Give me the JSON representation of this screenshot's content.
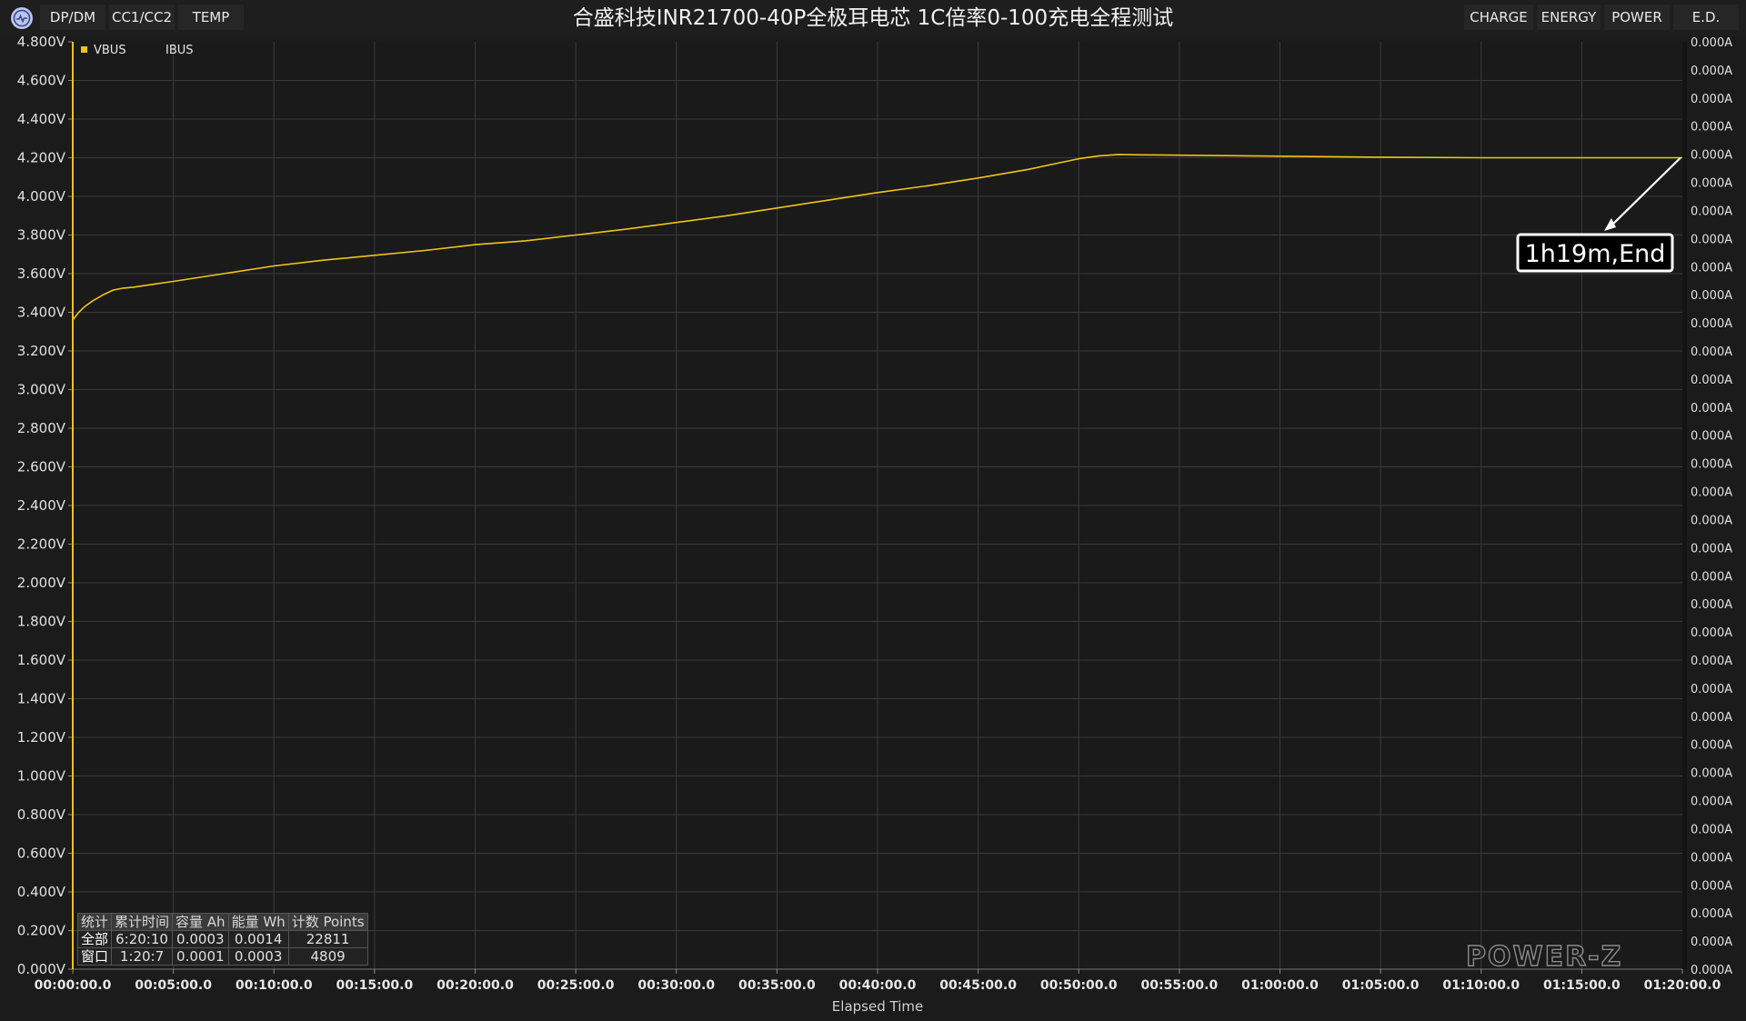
{
  "header": {
    "title": "合盛科技INR21700-40P全极耳电芯 1C倍率0-100充电全程测试",
    "left_tabs": [
      "DP/DM",
      "CC1/CC2",
      "TEMP"
    ],
    "right_tabs": [
      "CHARGE",
      "ENERGY",
      "POWER",
      "E.D."
    ]
  },
  "colors": {
    "vbus": "#f0c419",
    "background": "#1b1b1b",
    "plot_bg": "#1a1a1a",
    "grid": "#3a3a3a",
    "annotation_border": "#ffffff"
  },
  "chart_data": {
    "type": "line",
    "xlabel": "Elapsed Time",
    "x_ticks": [
      "00:00:00.0",
      "00:05:00.0",
      "00:10:00.0",
      "00:15:00.0",
      "00:20:00.0",
      "00:25:00.0",
      "00:30:00.0",
      "00:35:00.0",
      "00:40:00.0",
      "00:45:00.0",
      "00:50:00.0",
      "00:55:00.0",
      "01:00:00.0",
      "01:05:00.0",
      "01:10:00.0",
      "01:15:00.0",
      "01:20:00.0"
    ],
    "xlim_minutes": [
      0,
      80
    ],
    "y_left": {
      "unit": "V",
      "lim": [
        0,
        4.8
      ],
      "ticks": [
        "0.000V",
        "0.200V",
        "0.400V",
        "0.600V",
        "0.800V",
        "1.000V",
        "1.200V",
        "1.400V",
        "1.600V",
        "1.800V",
        "2.000V",
        "2.200V",
        "2.400V",
        "2.600V",
        "2.800V",
        "3.000V",
        "3.200V",
        "3.400V",
        "3.600V",
        "3.800V",
        "4.000V",
        "4.200V",
        "4.400V",
        "4.600V",
        "4.800V"
      ]
    },
    "y_right": {
      "unit": "A",
      "ticks": [
        "0.000A",
        "0.000A",
        "0.000A",
        "0.000A",
        "0.000A",
        "0.000A",
        "0.000A",
        "0.000A",
        "0.000A",
        "0.000A",
        "0.000A",
        "0.000A",
        "0.000A",
        "0.000A",
        "0.000A",
        "0.000A",
        "0.000A",
        "0.000A",
        "0.000A",
        "0.000A",
        "0.000A",
        "0.000A",
        "0.000A",
        "0.000A",
        "0.000A",
        "0.000A",
        "0.000A",
        "0.000A",
        "0.000A",
        "0.000A",
        "0.000A",
        "0.000A",
        "0.000A",
        "0.000A"
      ]
    },
    "legend": [
      "VBUS",
      "IBUS"
    ],
    "legend_position": "top-left",
    "grid": true,
    "series": [
      {
        "name": "VBUS",
        "x_minutes": [
          0,
          0.3,
          0.6,
          1.0,
          1.5,
          2.0,
          2.5,
          3.0,
          4.0,
          5.0,
          7.5,
          10.0,
          12.5,
          15.0,
          17.5,
          20.0,
          22.5,
          25.0,
          27.5,
          30.0,
          32.5,
          35.0,
          37.5,
          40.0,
          42.5,
          45.0,
          47.5,
          50.0,
          51.0,
          52.0,
          53.0,
          55.0,
          60.0,
          65.0,
          70.0,
          75.0,
          80.0
        ],
        "values": [
          3.36,
          3.4,
          3.43,
          3.46,
          3.49,
          3.515,
          3.525,
          3.53,
          3.545,
          3.56,
          3.6,
          3.64,
          3.67,
          3.695,
          3.72,
          3.75,
          3.77,
          3.8,
          3.83,
          3.865,
          3.9,
          3.94,
          3.98,
          4.02,
          4.055,
          4.095,
          4.14,
          4.195,
          4.21,
          4.217,
          4.215,
          4.213,
          4.208,
          4.203,
          4.2,
          4.2,
          4.2
        ]
      },
      {
        "name": "IBUS",
        "x_minutes": [
          0,
          80
        ],
        "values": [
          0,
          0
        ]
      }
    ],
    "annotations": [
      {
        "text": "1h19m,End",
        "x_minutes": 80,
        "value": 4.2
      }
    ]
  },
  "stats": {
    "headers": [
      "统计",
      "累计时间",
      "容量 Ah",
      "能量 Wh",
      "计数 Points"
    ],
    "rows": [
      [
        "全部",
        "6:20:10",
        "0.0003",
        "0.0014",
        "22811"
      ],
      [
        "窗口",
        "1:20:7",
        "0.0001",
        "0.0003",
        "4809"
      ]
    ]
  },
  "watermark": "POWER-Z"
}
